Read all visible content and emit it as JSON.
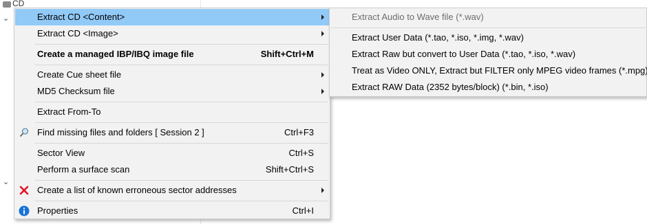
{
  "background": {
    "drive_label": "CD"
  },
  "menu": {
    "items": [
      {
        "label": "Extract CD  <Content>",
        "shortcut": ""
      },
      {
        "label": "Extract CD  <Image>",
        "shortcut": ""
      },
      {
        "label": "Create a managed IBP/IBQ image file",
        "shortcut": "Shift+Ctrl+M"
      },
      {
        "label": "Create Cue sheet file",
        "shortcut": ""
      },
      {
        "label": "MD5 Checksum file",
        "shortcut": ""
      },
      {
        "label": "Extract From-To",
        "shortcut": ""
      },
      {
        "label": "Find missing files and folders [ Session 2 ]",
        "shortcut": "Ctrl+F3"
      },
      {
        "label": "Sector View",
        "shortcut": "Ctrl+S"
      },
      {
        "label": "Perform a surface scan",
        "shortcut": "Shift+Ctrl+S"
      },
      {
        "label": "Create a list of known erroneous sector addresses",
        "shortcut": ""
      },
      {
        "label": "Properties",
        "shortcut": "Ctrl+I"
      }
    ]
  },
  "submenu": {
    "items": [
      {
        "label": "Extract Audio to Wave file (*.wav)",
        "disabled": true
      },
      {
        "label": "Extract User Data (*.tao, *.iso, *.img, *.wav)",
        "disabled": false
      },
      {
        "label": "Extract Raw but convert to User Data (*.tao, *.iso, *.wav)",
        "disabled": false
      },
      {
        "label": "Treat as Video ONLY, Extract but FILTER only MPEG video frames (*.mpg)",
        "disabled": false
      },
      {
        "label": "Extract RAW Data (2352 bytes/block) (*.bin, *.iso)",
        "disabled": false
      }
    ]
  },
  "colors": {
    "highlight": "#91c9f7",
    "menu_bg": "#f2f2f2",
    "error_icon": "#e81123",
    "info_icon": "#1a73d6"
  },
  "icons": {
    "find": "magnifier-icon",
    "errors": "red-x-icon",
    "properties": "info-icon"
  }
}
